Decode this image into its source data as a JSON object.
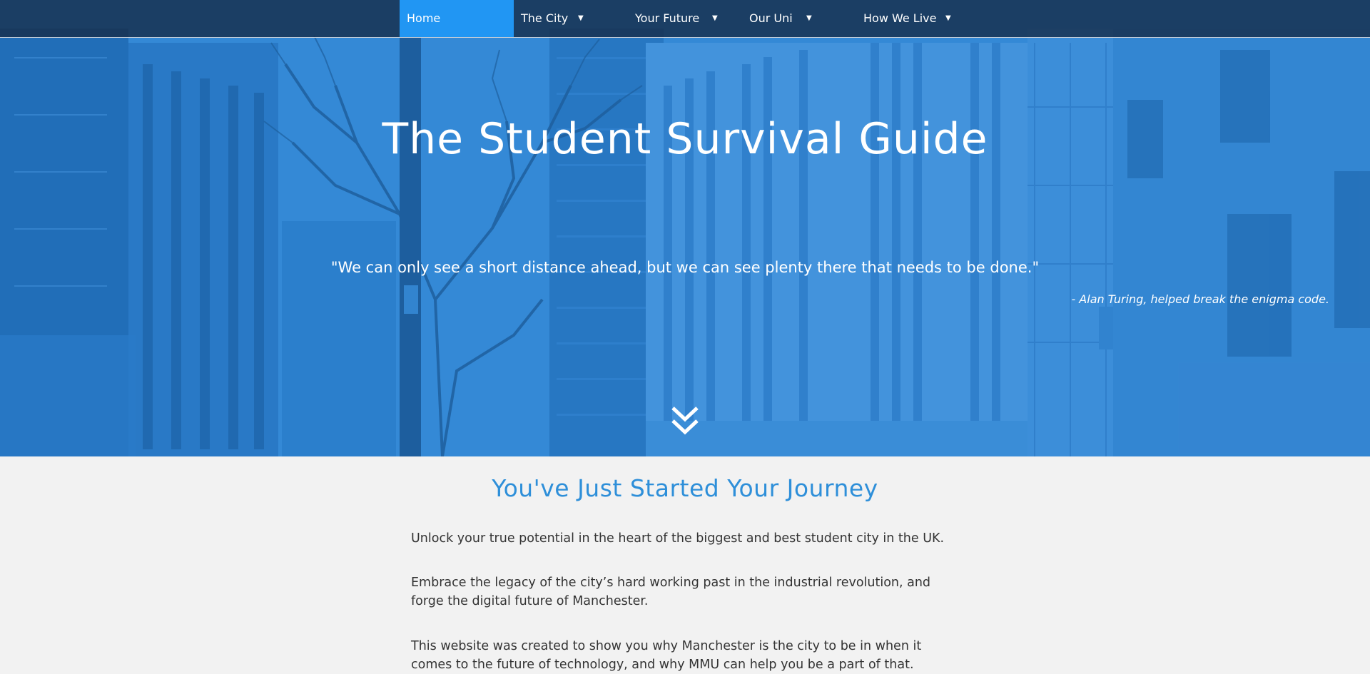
{
  "nav": {
    "items": [
      {
        "label": "Home",
        "active": true,
        "has_dropdown": false
      },
      {
        "label": "The City",
        "active": false,
        "has_dropdown": true
      },
      {
        "label": "Your Future",
        "active": false,
        "has_dropdown": true
      },
      {
        "label": "Our Uni",
        "active": false,
        "has_dropdown": true
      },
      {
        "label": "How We Live",
        "active": false,
        "has_dropdown": true
      }
    ],
    "caret_glyph": "▼"
  },
  "hero": {
    "title": "The Student Survival Guide",
    "quote": "\"We can only see a short distance ahead, but we can see plenty there that needs to be done.\"",
    "attribution": "- Alan Turing, helped break the enigma code.",
    "scroll_icon": "double-chevron-down-icon"
  },
  "content": {
    "heading": "You've Just Started Your Journey",
    "paragraphs": [
      "Unlock your true potential in the heart of the biggest and best student city in the UK.",
      "Embrace the legacy of the city’s hard working past in the industrial revolution, and forge the digital future of Manchester.",
      "This website was created to show you why Manchester is the city to be in when it comes to the future of technology, and why MMU can help you be a part of that."
    ]
  },
  "colors": {
    "accent": "#2196f3",
    "heading_blue": "#2e8fd9",
    "nav_background": "#162d4b",
    "page_background": "#f2f2f2",
    "body_text": "#333333"
  }
}
